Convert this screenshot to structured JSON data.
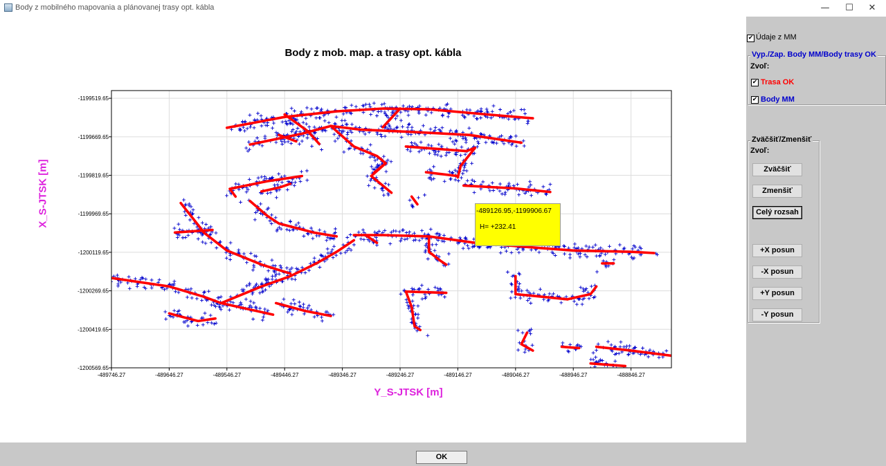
{
  "window": {
    "title": "Body z mobilného mapovania a plánovanej trasy opt. kábla",
    "minimize": "—",
    "maximize": "☐",
    "close": "✕"
  },
  "chart": {
    "tooltip": {
      "coords": "-489126.95,-1199906.67",
      "height": "H=  +232.41"
    }
  },
  "chart_data": {
    "type": "scatter",
    "title": "Body z mob. map. a trasy opt. kábla",
    "xlabel": "Y_S-JTSK [m]",
    "ylabel": "X_S-JTSK [m]",
    "xlim": [
      -489746.27,
      -488776.27
    ],
    "ylim": [
      -1200569.65,
      -1199489.65
    ],
    "x_ticks": [
      "-489746.27",
      "-489646.27",
      "-489546.27",
      "-489446.27",
      "-489346.27",
      "-489246.27",
      "-489146.27",
      "-489046.27",
      "-488946.27",
      "-488846.27"
    ],
    "y_ticks": [
      "-1199519.65",
      "-1199669.65",
      "-1199819.65",
      "-1199969.65",
      "-1200119.65",
      "-1200269.65",
      "-1200419.65",
      "-1200569.65"
    ],
    "grid": true,
    "colors": {
      "trasa": "#ff0000",
      "body": "#0000cc"
    },
    "series": [
      {
        "name": "Trasa OK",
        "style": "thick-line",
        "color": "#ff0000",
        "polylines": [
          [
            [
              -489546.27,
              -1199634.65
            ],
            [
              -489446.27,
              -1199592.65
            ],
            [
              -489356.27,
              -1199570.65
            ],
            [
              -489276.27,
              -1199559.65
            ],
            [
              -489196.27,
              -1199562.65
            ],
            [
              -489096.27,
              -1199582.65
            ],
            [
              -489016.27,
              -1199597.65
            ]
          ],
          [
            [
              -489506.27,
              -1199699.65
            ],
            [
              -489416.27,
              -1199657.65
            ],
            [
              -489366.27,
              -1199627.65
            ],
            [
              -489316.27,
              -1199641.65
            ],
            [
              -489226.27,
              -1199650.65
            ],
            [
              -489126.27,
              -1199662.65
            ],
            [
              -489036.27,
              -1199692.65
            ]
          ],
          [
            [
              -489446.27,
              -1199582.65
            ],
            [
              -489406.27,
              -1199647.65
            ],
            [
              -489386.27,
              -1199697.65
            ]
          ],
          [
            [
              -489456.27,
              -1199662.65
            ],
            [
              -489426.27,
              -1199687.65
            ]
          ],
          [
            [
              -489366.27,
              -1199627.65
            ],
            [
              -489326.27,
              -1199707.65
            ],
            [
              -489286.27,
              -1199744.65
            ],
            [
              -489271.27,
              -1199772.65
            ],
            [
              -489296.27,
              -1199822.65
            ],
            [
              -489261.27,
              -1199887.65
            ]
          ],
          [
            [
              -489271.27,
              -1199772.65
            ],
            [
              -489291.27,
              -1199809.65
            ]
          ],
          [
            [
              -489246.27,
              -1199559.65
            ],
            [
              -489276.27,
              -1199632.65
            ]
          ],
          [
            [
              -489236.27,
              -1199707.65
            ],
            [
              -489131.27,
              -1199725.65
            ],
            [
              -489116.27,
              -1199712.65
            ],
            [
              -489141.27,
              -1199782.65
            ],
            [
              -489146.27,
              -1199827.65
            ]
          ],
          [
            [
              -489201.27,
              -1199807.65
            ],
            [
              -489146.27,
              -1199822.65
            ]
          ],
          [
            [
              -489136.27,
              -1199859.65
            ],
            [
              -489046.27,
              -1199870.65
            ],
            [
              -488986.27,
              -1199884.65
            ]
          ],
          [
            [
              -489226.27,
              -1199902.65
            ],
            [
              -489216.27,
              -1199932.65
            ]
          ],
          [
            [
              -489416.27,
              -1199822.65
            ],
            [
              -489476.27,
              -1199842.65
            ],
            [
              -489541.27,
              -1199872.65
            ],
            [
              -489531.27,
              -1199902.65
            ]
          ],
          [
            [
              -489626.27,
              -1199927.65
            ],
            [
              -489596.27,
              -1200012.65
            ],
            [
              -489586.27,
              -1200042.65
            ],
            [
              -489546.27,
              -1200112.65
            ],
            [
              -489486.27,
              -1200167.65
            ],
            [
              -489436.27,
              -1200202.65
            ]
          ],
          [
            [
              -489636.27,
              -1200042.65
            ],
            [
              -489571.27,
              -1200032.65
            ]
          ],
          [
            [
              -489506.27,
              -1199919.65
            ],
            [
              -489476.27,
              -1199977.65
            ],
            [
              -489456.27,
              -1200007.65
            ],
            [
              -489396.27,
              -1200042.65
            ],
            [
              -489356.27,
              -1200057.65
            ]
          ],
          [
            [
              -489486.27,
              -1199882.65
            ],
            [
              -489456.27,
              -1199867.65
            ],
            [
              -489436.27,
              -1199852.65
            ]
          ],
          [
            [
              -489746.27,
              -1200219.65
            ],
            [
              -489646.27,
              -1200252.65
            ],
            [
              -489586.27,
              -1200292.65
            ],
            [
              -489556.27,
              -1200317.65
            ],
            [
              -489526.27,
              -1200332.65
            ],
            [
              -489466.27,
              -1200362.65
            ]
          ],
          [
            [
              -489556.27,
              -1200317.65
            ],
            [
              -489486.27,
              -1200252.65
            ],
            [
              -489436.27,
              -1200212.65
            ],
            [
              -489391.27,
              -1200162.65
            ],
            [
              -489356.27,
              -1200117.65
            ],
            [
              -489326.27,
              -1200072.65
            ]
          ],
          [
            [
              -489461.27,
              -1200317.65
            ],
            [
              -489411.27,
              -1200347.65
            ]
          ],
          [
            [
              -489411.27,
              -1200347.65
            ],
            [
              -489366.27,
              -1200367.65
            ]
          ],
          [
            [
              -489646.27,
              -1200357.65
            ],
            [
              -489596.27,
              -1200387.65
            ],
            [
              -489566.27,
              -1200377.65
            ]
          ],
          [
            [
              -489326.27,
              -1200052.65
            ],
            [
              -489276.27,
              -1200052.65
            ],
            [
              -489196.27,
              -1200057.65
            ],
            [
              -489116.27,
              -1200082.65
            ],
            [
              -489006.27,
              -1200102.65
            ],
            [
              -488946.27,
              -1200112.65
            ],
            [
              -488846.27,
              -1200117.65
            ],
            [
              -488806.27,
              -1200122.65
            ]
          ],
          [
            [
              -489306.27,
              -1200052.65
            ],
            [
              -489286.27,
              -1200082.65
            ]
          ],
          [
            [
              -489196.27,
              -1200062.65
            ],
            [
              -489196.27,
              -1200117.65
            ],
            [
              -489176.27,
              -1200152.65
            ],
            [
              -489166.27,
              -1200167.65
            ]
          ],
          [
            [
              -489236.27,
              -1200272.65
            ],
            [
              -489226.27,
              -1200332.65
            ],
            [
              -489221.27,
              -1200407.65
            ],
            [
              -489211.27,
              -1200422.65
            ]
          ],
          [
            [
              -489236.27,
              -1200272.65
            ],
            [
              -489166.27,
              -1200277.65
            ]
          ],
          [
            [
              -489046.27,
              -1200212.65
            ],
            [
              -489046.27,
              -1200282.65
            ],
            [
              -488956.27,
              -1200302.65
            ]
          ],
          [
            [
              -488956.27,
              -1200302.65
            ],
            [
              -488916.27,
              -1200282.65
            ],
            [
              -488906.27,
              -1200252.65
            ]
          ],
          [
            [
              -488896.27,
              -1200162.65
            ],
            [
              -488876.27,
              -1200162.65
            ]
          ],
          [
            [
              -489026.27,
              -1200432.65
            ],
            [
              -489036.27,
              -1200477.65
            ],
            [
              -489016.27,
              -1200502.65
            ]
          ],
          [
            [
              -488966.27,
              -1200487.65
            ],
            [
              -488936.27,
              -1200492.65
            ]
          ],
          [
            [
              -488906.27,
              -1200487.65
            ],
            [
              -488846.27,
              -1200502.65
            ],
            [
              -488776.27,
              -1200522.65
            ]
          ],
          [
            [
              -488916.27,
              -1200552.65
            ],
            [
              -488856.27,
              -1200562.65
            ]
          ]
        ]
      },
      {
        "name": "Body MM",
        "style": "plus-markers",
        "color": "#0000cc"
      }
    ]
  },
  "panel": {
    "udaje_label": "Údaje z MM",
    "udaje_checked": true,
    "group1_title": "Vyp./Zap. Body MM/Body trasy OK",
    "zvol1": "Zvoľ:",
    "trasa_label": "Trasa OK",
    "trasa_checked": true,
    "body_label": "Body MM",
    "body_checked": true,
    "group2_title": "Zväčšiť/Zmenšiť",
    "zvol2": "Zvoľ:",
    "btn_zvacsit": "Zväčšiť",
    "btn_zmensit": "Zmenšiť",
    "btn_cely": "Celý rozsah",
    "btn_plus_x": "+X posun",
    "btn_minus_x": "-X posun",
    "btn_plus_y": "+Y posun",
    "btn_minus_y": "-Y posun"
  },
  "footer": {
    "ok_label": "OK"
  }
}
